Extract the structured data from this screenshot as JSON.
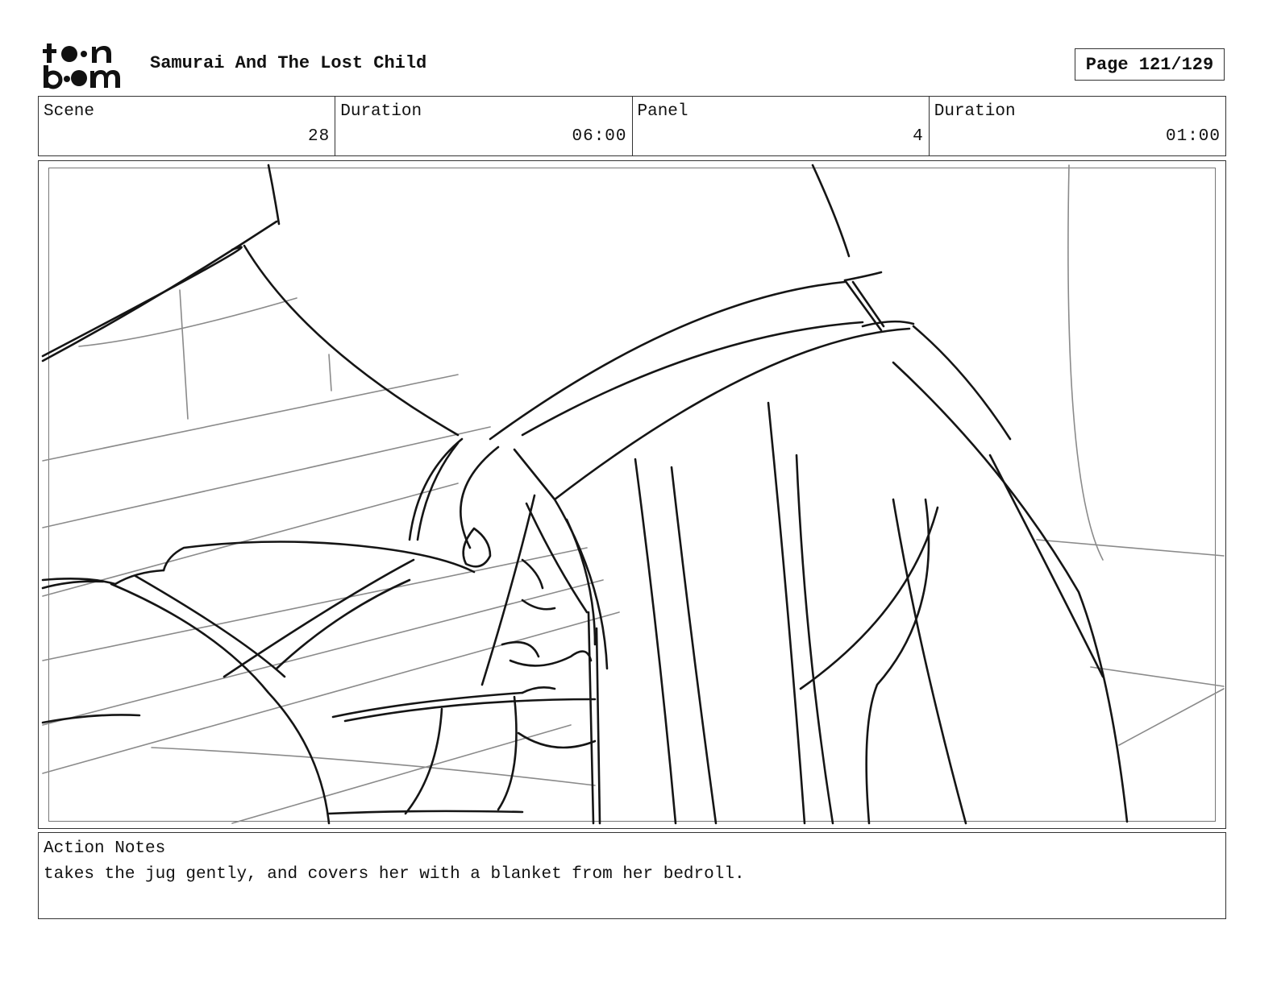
{
  "brand": {
    "logo_text": "toonboom"
  },
  "header": {
    "project_title": "Samurai And The Lost Child",
    "page_label": "Page 121/129"
  },
  "info": {
    "scene_label": "Scene",
    "scene_value": "28",
    "scene_duration_label": "Duration",
    "scene_duration_value": "06:00",
    "panel_label": "Panel",
    "panel_value": "4",
    "panel_duration_label": "Duration",
    "panel_duration_value": "01:00"
  },
  "notes": {
    "label": "Action Notes",
    "text": "takes the jug gently, and covers her with a blanket from her bedroll."
  }
}
